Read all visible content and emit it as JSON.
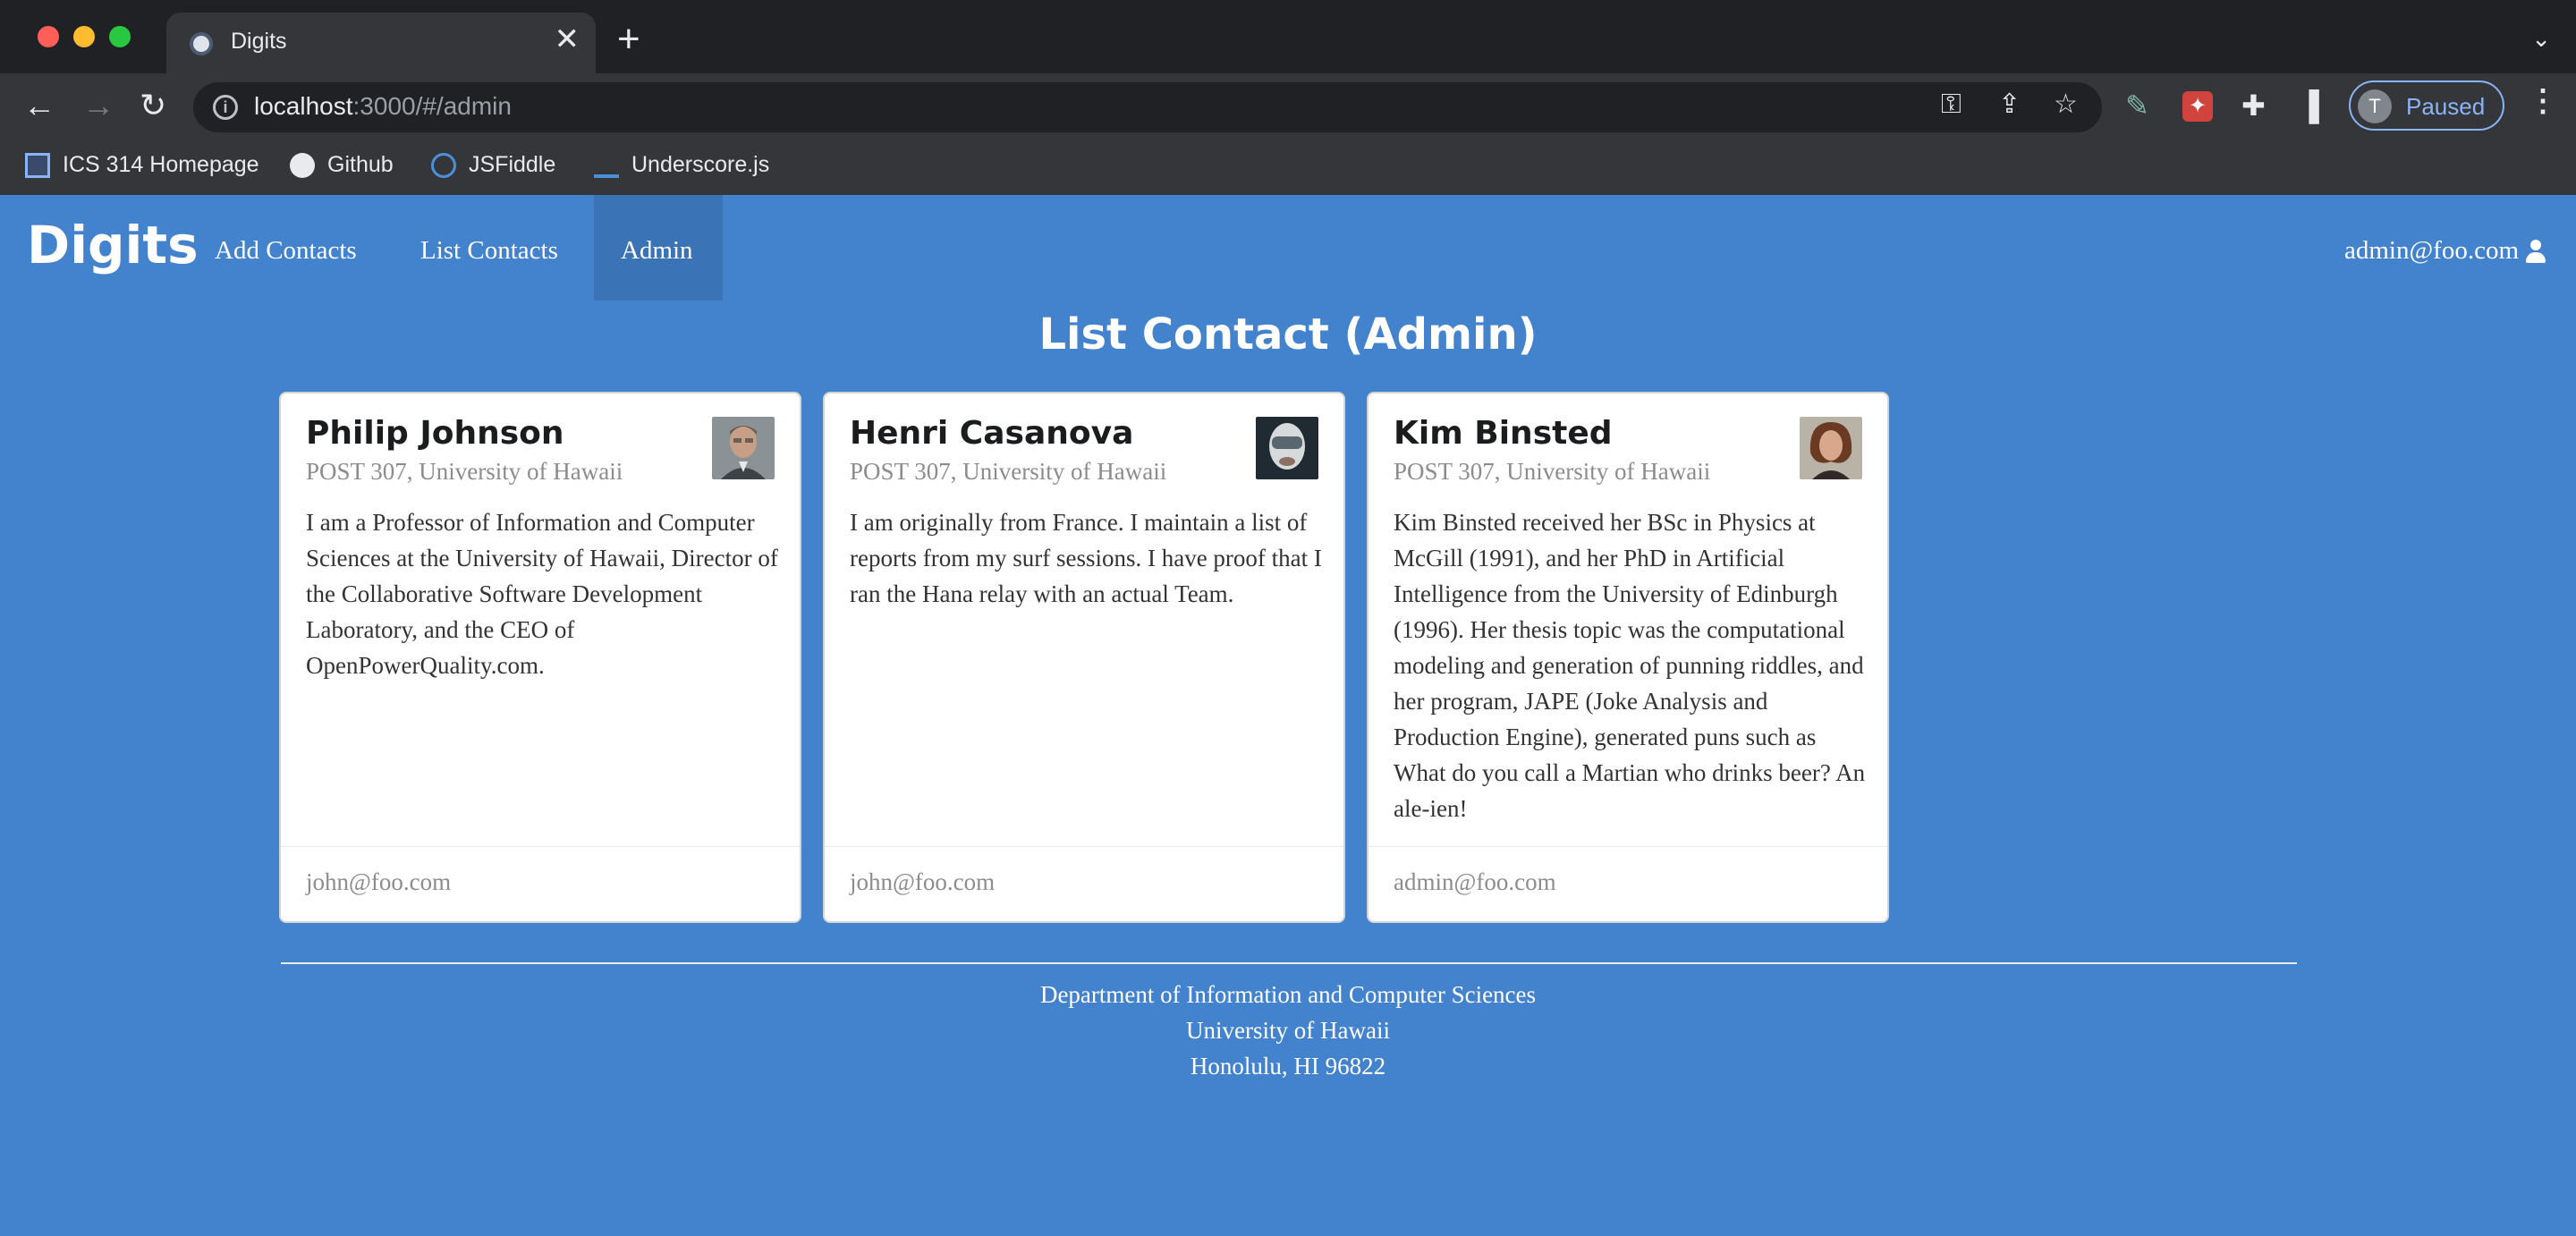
{
  "browser": {
    "tab_title": "Digits",
    "tab_close": "✕",
    "new_tab": "+",
    "url_host": "localhost",
    "url_rest": ":3000/#/admin",
    "profile_initial": "T",
    "profile_label": "Paused",
    "bookmarks": [
      "ICS 314 Homepage",
      "Github",
      "JSFiddle",
      "Underscore.js"
    ]
  },
  "navbar": {
    "brand": "Digits",
    "links": [
      "Add Contacts",
      "List Contacts",
      "Admin"
    ],
    "active": "Admin",
    "user": "admin@foo.com"
  },
  "page": {
    "title": "List Contact (Admin)"
  },
  "contacts": [
    {
      "name": "Philip Johnson",
      "address": "POST 307, University of Hawaii",
      "description": "I am a Professor of Information and Computer Sciences at the University of Hawaii, Director of the Collaborative Software Development Laboratory, and the CEO of OpenPowerQuality.com.",
      "owner": "john@foo.com"
    },
    {
      "name": "Henri Casanova",
      "address": "POST 307, University of Hawaii",
      "description": "I am originally from France. I maintain a list of reports from my surf sessions. I have proof that I ran the Hana relay with an actual Team.",
      "owner": "john@foo.com"
    },
    {
      "name": "Kim Binsted",
      "address": "POST 307, University of Hawaii",
      "description": "Kim Binsted received her BSc in Physics at McGill (1991), and her PhD in Artificial Intelligence from the University of Edinburgh (1996). Her thesis topic was the computational modeling and generation of punning riddles, and her program, JAPE (Joke Analysis and Production Engine), generated puns such as What do you call a Martian who drinks beer? An ale-ien!",
      "owner": "admin@foo.com"
    }
  ],
  "footer": {
    "line1": "Department of Information and Computer Sciences",
    "line2": "University of Hawaii",
    "line3": "Honolulu, HI 96822"
  }
}
